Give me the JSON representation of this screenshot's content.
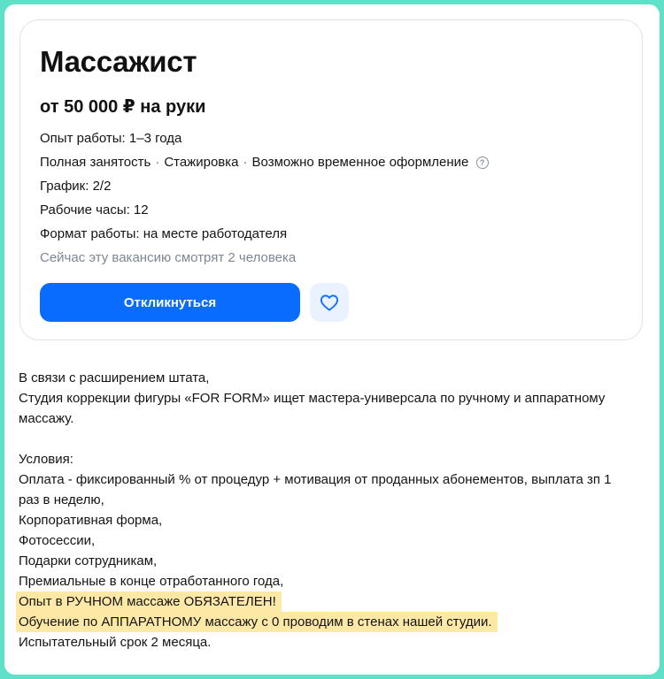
{
  "vacancy": {
    "title": "Массажист",
    "salary": "от 50 000 ₽ на руки",
    "experience": "Опыт работы: 1–3 года",
    "employment": [
      "Полная занятость",
      "Стажировка",
      "Возможно временное оформление"
    ],
    "employment_separator": "·",
    "help_icon_glyph": "?",
    "schedule": "График: 2/2",
    "hours": "Рабочие часы: 12",
    "format": "Формат работы: на месте работодателя",
    "viewers": "Сейчас эту вакансию смотрят 2 человека",
    "apply_label": "Откликнуться",
    "favorite_icon": "heart-icon",
    "accent_color": "#0a6cff"
  },
  "description": {
    "intro": [
      "В связи с расширением штата,",
      "Студия коррекции фигуры «FOR FORM» ищет мастера-универсала по ручному и аппаратному",
      "массажу."
    ],
    "conditions_title": "Условия:",
    "conditions": [
      "Оплата - фиксированный % от процедур + мотивация от проданных абонементов, выплата зп 1",
      "раз в неделю,",
      "Корпоративная форма,",
      "Фотосессии,",
      "Подарки сотрудникам,",
      "Премиальные в конце отработанного года,"
    ],
    "highlighted": [
      "Опыт в РУЧНОМ массаже ОБЯЗАТЕЛЕН!",
      "Обучение по АППАРАТНОМУ массажу с 0 проводим в стенах нашей студии."
    ],
    "trial": "Испытательный срок 2 месяца.",
    "highlight_color": "#fde8a6"
  }
}
